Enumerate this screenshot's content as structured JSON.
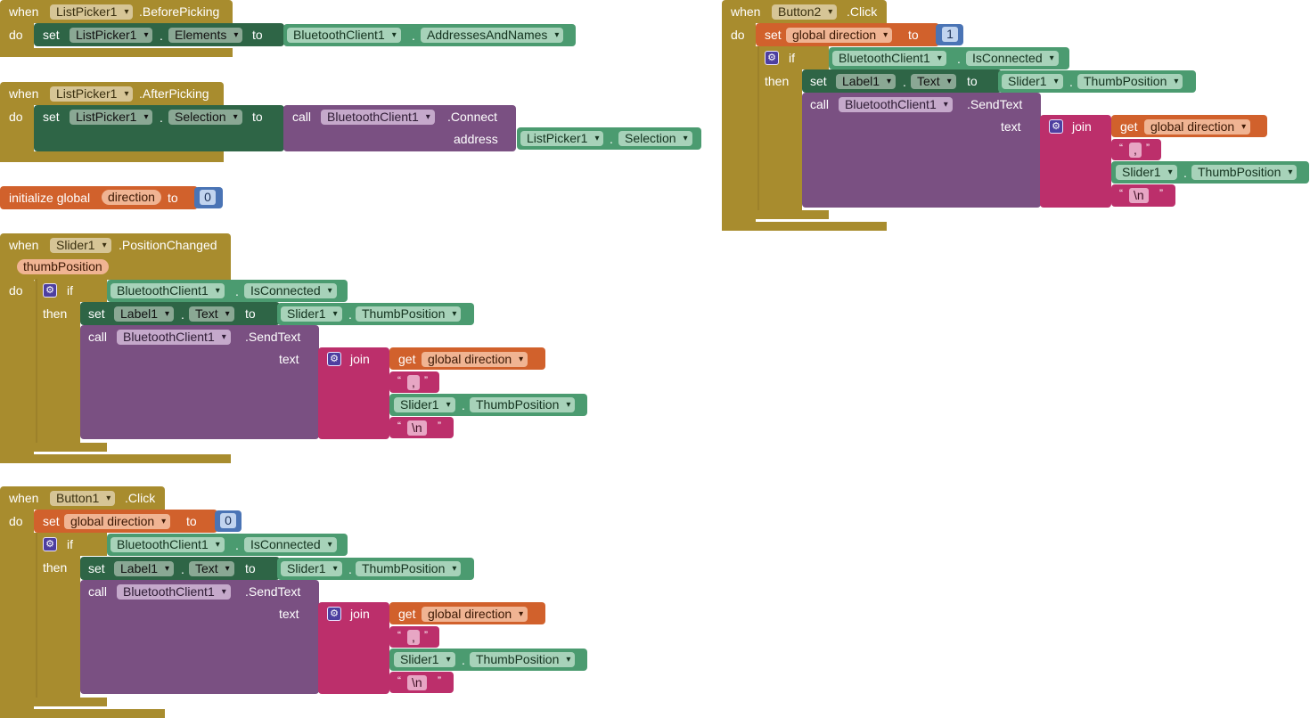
{
  "kw": {
    "when": "when",
    "do": "do",
    "set": "set",
    "to": "to",
    "call": "call",
    "if": "if",
    "then": "then",
    "get": "get",
    "join": "join",
    "text": "text",
    "address": "address",
    "dot": ".",
    "init_global": "initialize global",
    "open_q": "“",
    "close_q": "”"
  },
  "components": {
    "listpicker": "ListPicker1",
    "bt": "BluetoothClient1",
    "slider": "Slider1",
    "label": "Label1",
    "button1": "Button1",
    "button2": "Button2"
  },
  "props": {
    "elements": "Elements",
    "addresses": "AddressesAndNames",
    "selection": "Selection",
    "isconnected": "IsConnected",
    "text": "Text",
    "thumbpos": "ThumbPosition"
  },
  "events": {
    "before_picking": ".BeforePicking",
    "after_picking": ".AfterPicking",
    "position_changed": ".PositionChanged",
    "click": ".Click"
  },
  "methods": {
    "connect": ".Connect",
    "sendtext": ".SendText"
  },
  "vars": {
    "direction": "direction",
    "global_direction": "global direction",
    "param_thumb": "thumbPosition"
  },
  "literals": {
    "zero": "0",
    "one": "1",
    "comma": ",",
    "newline": "\\n"
  },
  "colors": {
    "event": "#a88c2e",
    "setter": "#2e6546",
    "procedure": "#7a5082",
    "text": "#bc2f6b",
    "variable": "#d1612c",
    "component": "#4b9b70",
    "math": "#4a74b5"
  }
}
